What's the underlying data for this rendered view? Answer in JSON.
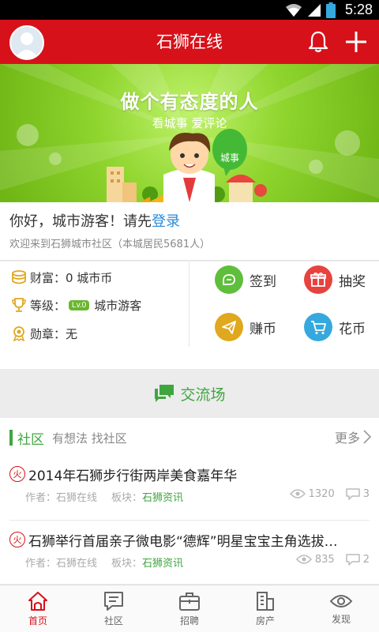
{
  "status_bar": {
    "time": "5:28"
  },
  "header": {
    "title": "石狮在线"
  },
  "banner": {
    "title": "做个有态度的人",
    "subtitle": "看城事  爱评论",
    "bubble": "城事"
  },
  "greeting": {
    "prefix": "你好，城市游客！请先",
    "login": "登录",
    "welcome": "欢迎来到石狮城市社区（本城居民5681人）"
  },
  "user_info": {
    "wealth": "财富：0 城市币",
    "level_prefix": "等级：",
    "level_badge": "Lv.0",
    "level_name": "城市游客",
    "medal": "勋章：无"
  },
  "actions": [
    {
      "label": "签到",
      "color": "#5fbe3c"
    },
    {
      "label": "抽奖",
      "color": "#e8423f"
    },
    {
      "label": "赚币",
      "color": "#e0a81e"
    },
    {
      "label": "花币",
      "color": "#35a9de"
    }
  ],
  "exchange": {
    "label": "交流场"
  },
  "community": {
    "title": "社区",
    "subtitle": "有想法 找社区",
    "more": "更多",
    "posts": [
      {
        "hot": "火",
        "title": "2014年石狮步行街两岸美食嘉年华",
        "author": "作者：石狮在线",
        "board_label": "板块：",
        "board": "石狮资讯",
        "views": "1320",
        "comments": "3"
      },
      {
        "hot": "火",
        "title": "石狮举行首届亲子微电影“德辉”明星宝宝主角选拔…",
        "author": "作者：石狮在线",
        "board_label": "板块：",
        "board": "石狮资讯",
        "views": "835",
        "comments": "2"
      }
    ]
  },
  "tabs": [
    {
      "label": "首页",
      "icon": "home-icon",
      "active": true
    },
    {
      "label": "社区",
      "icon": "community-icon",
      "active": false
    },
    {
      "label": "招聘",
      "icon": "briefcase-icon",
      "active": false
    },
    {
      "label": "房产",
      "icon": "building-icon",
      "active": false
    },
    {
      "label": "发现",
      "icon": "eye-icon",
      "active": false
    }
  ],
  "colors": {
    "primary_red": "#d7111a",
    "green": "#3fa63f",
    "link_blue": "#2a8ad8"
  }
}
